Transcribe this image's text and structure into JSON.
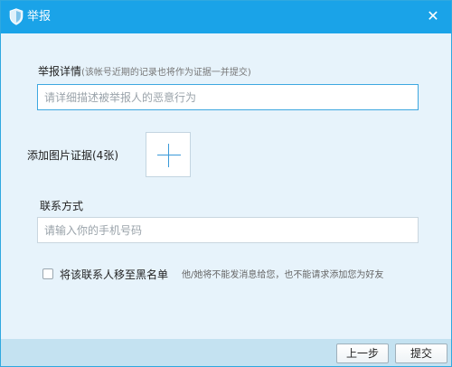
{
  "window": {
    "title": "举报",
    "close_glyph": "✕",
    "title_icon": "shield-icon",
    "accent_color": "#1aa3e8"
  },
  "detail": {
    "label": "举报详情",
    "hint": "(该帐号近期的记录也将作为证据一并提交)",
    "placeholder": "请详细描述被举报人的恶意行为",
    "value": ""
  },
  "photo": {
    "label": "添加图片证据(4张)",
    "add_icon": "plus-icon"
  },
  "contact": {
    "label": "联系方式",
    "placeholder": "请输入你的手机号码",
    "value": ""
  },
  "blacklist": {
    "checked": false,
    "label": "将该联系人移至黑名单",
    "note": "他/她将不能发消息给您，也不能请求添加您为好友"
  },
  "buttons": {
    "prev": "上一步",
    "submit": "提交"
  }
}
